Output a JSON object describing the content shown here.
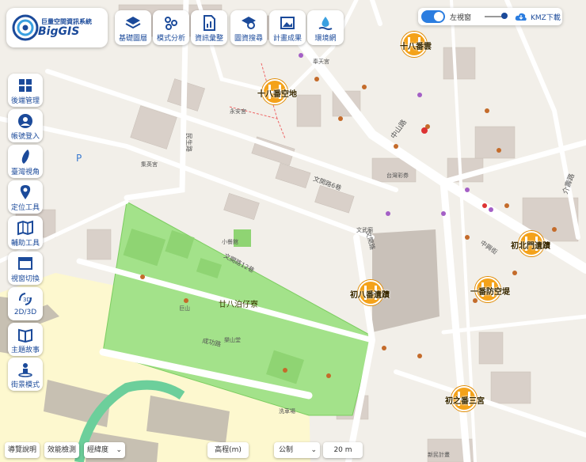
{
  "app": {
    "title": "巨量空間資訊系統",
    "brand": "BigGIS"
  },
  "toolbar": {
    "items": [
      {
        "label": "基礎圖層",
        "icon": "layers-icon"
      },
      {
        "label": "模式分析",
        "icon": "network-icon"
      },
      {
        "label": "資訊彙整",
        "icon": "document-chart-icon"
      },
      {
        "label": "圖資搜尋",
        "icon": "search-layer-icon"
      },
      {
        "label": "計畫成果",
        "icon": "image-icon"
      },
      {
        "label": "環境網",
        "icon": "water-icon"
      }
    ]
  },
  "sidebar": {
    "items": [
      {
        "label": "後端管理",
        "icon": "dashboard-icon"
      },
      {
        "label": "帳號登入",
        "icon": "user-icon"
      },
      {
        "label": "臺灣視角",
        "icon": "taiwan-icon"
      },
      {
        "label": "定位工具",
        "icon": "location-pin-icon"
      },
      {
        "label": "輔助工具",
        "icon": "map-tools-icon"
      },
      {
        "label": "視窗切換",
        "icon": "window-icon"
      },
      {
        "label": "2D/3D",
        "icon": "3d-icon"
      },
      {
        "label": "主題故事",
        "icon": "book-icon"
      },
      {
        "label": "街景模式",
        "icon": "streetview-icon"
      }
    ]
  },
  "top_right": {
    "toggle_label": "左視窗",
    "download_label": "KMZ下載"
  },
  "bottom": {
    "guide": "導覽說明",
    "perf": "效能檢測",
    "coord_select": "經緯度",
    "distance_label": "高程(m)",
    "unit_select": "公制",
    "scale": "20 m"
  },
  "markers": [
    {
      "label": "十八番雲"
    },
    {
      "label": "十八番空地"
    },
    {
      "label": "初北門遺蹟"
    },
    {
      "label": "初八番遺蹟"
    },
    {
      "label": "一番防空堤"
    },
    {
      "label": "初之番三宮"
    }
  ],
  "park_label": "廿八泊仔寮",
  "map_labels": {
    "zhongshan": "中山路",
    "wencheng6": "文開路6巷",
    "wenkai": "文開路",
    "minsheng": "民生路",
    "wenkai12": "文開路12巷",
    "chenggong": "成功路",
    "jieshou": "介壽路",
    "yongan": "永安宮",
    "jiying": "集英宮",
    "tainan": "台灣彩券",
    "fengtian": "奉天宮",
    "wenwu": "文武廟",
    "jushan": "巨山",
    "leshan": "樂山堂",
    "xiaocan": "小餐館",
    "xichang": "洗車場",
    "xinmin": "新民計畫",
    "zhongxing": "中興街"
  },
  "colors": {
    "park": "#a3e28a",
    "brand": "#1b4a9a",
    "marker": "#f4a21a",
    "accent": "#2b7de0"
  }
}
